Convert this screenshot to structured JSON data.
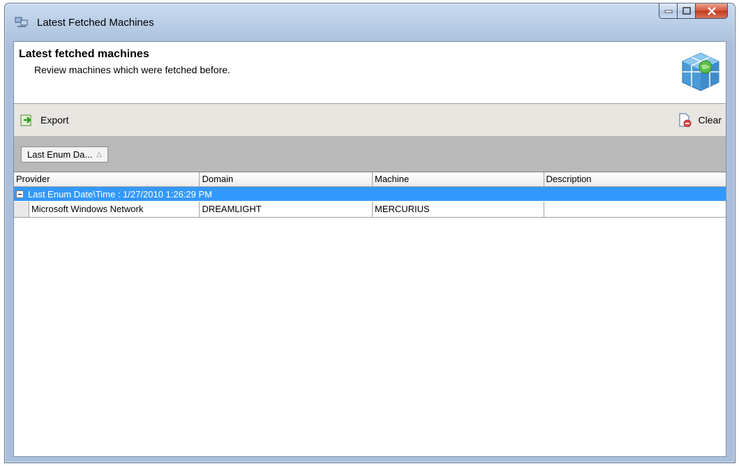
{
  "window": {
    "title": "Latest Fetched Machines"
  },
  "header": {
    "title": "Latest fetched machines",
    "subtitle": "Review machines which were fetched before."
  },
  "toolbar": {
    "export_label": "Export",
    "clear_label": "Clear"
  },
  "group_panel": {
    "chip_label": "Last Enum Da..."
  },
  "grid": {
    "columns": [
      "Provider",
      "Domain",
      "Machine",
      "Description"
    ],
    "group_row_label": "Last Enum Date\\Time : 1/27/2010 1:26:29 PM",
    "rows": [
      {
        "provider": "Microsoft Windows Network",
        "domain": "DREAMLIGHT",
        "machine": "MERCURIUS",
        "description": ""
      }
    ]
  },
  "colors": {
    "selection": "#3399ff",
    "group_panel": "#b9b9b9",
    "toolbar": "#e8e6e1"
  }
}
